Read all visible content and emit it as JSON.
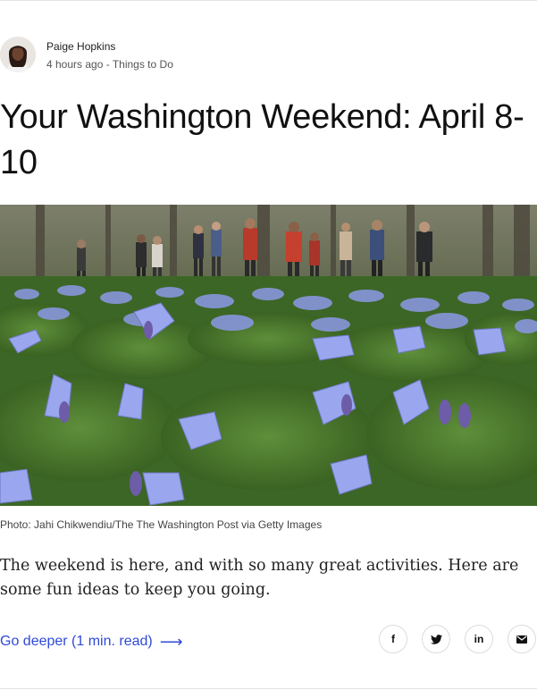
{
  "author": {
    "name": "Paige Hopkins",
    "meta": "4 hours ago - Things to Do"
  },
  "article": {
    "title": "Your Washington Weekend: April 8-10",
    "photo_caption": "Photo: Jahi Chikwendiu/The The Washington Post via Getty Images",
    "summary": "The weekend is here, and with so many great activities. Here are some fun ideas to keep you going.",
    "go_deeper_label": "Go deeper (1 min. read)",
    "go_deeper_arrow": "⟶"
  },
  "share": {
    "facebook_glyph": "f",
    "linkedin_glyph": "in",
    "icons": [
      "facebook-icon",
      "twitter-icon",
      "linkedin-icon",
      "email-icon"
    ]
  },
  "colors": {
    "link": "#2f4ad8",
    "divider": "#e3e3e3",
    "flower": "#8e9be6"
  }
}
